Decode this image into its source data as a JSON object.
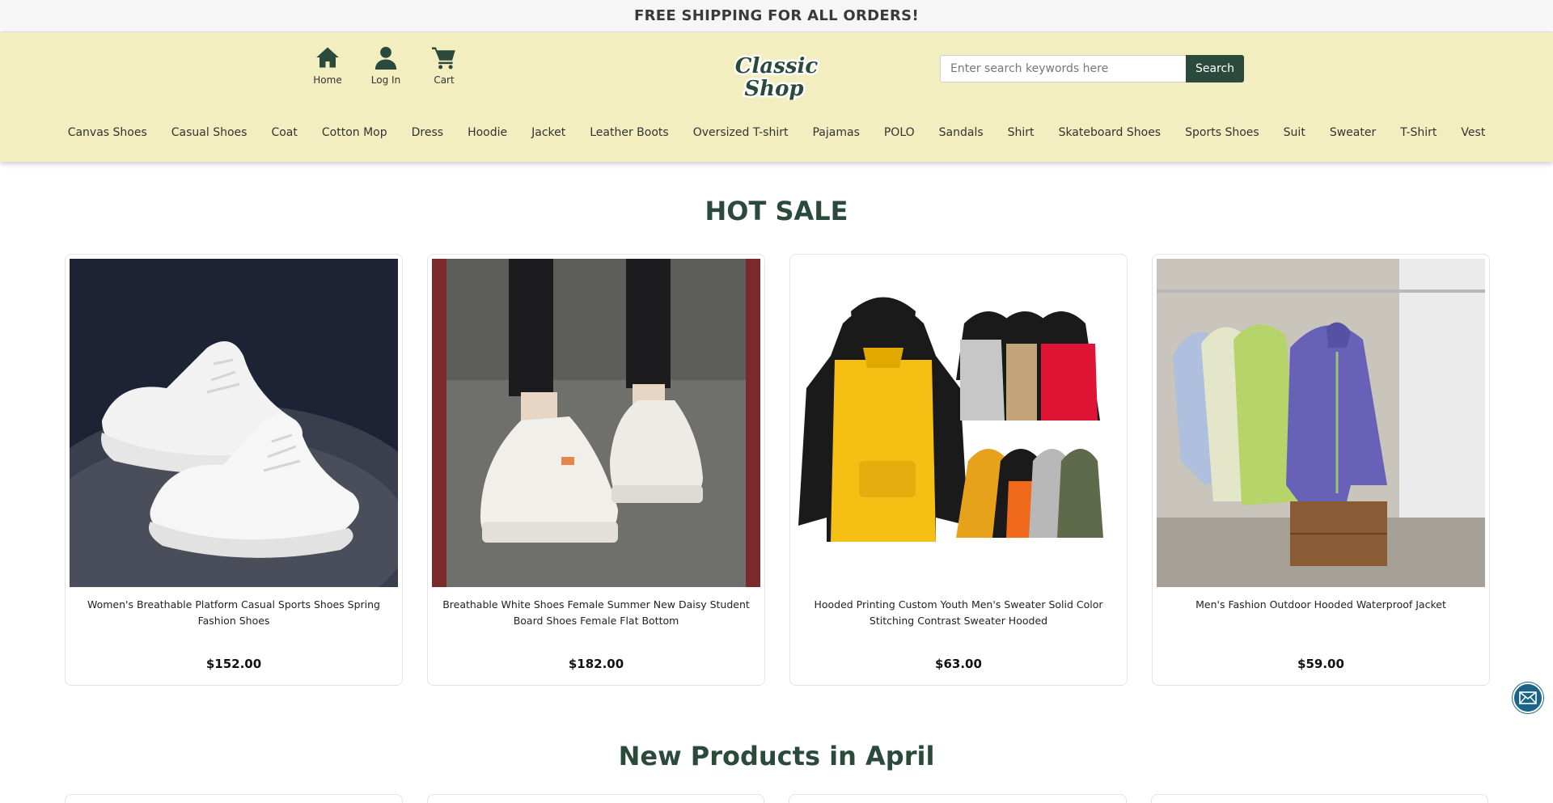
{
  "promo_banner": "FREE SHIPPING FOR ALL ORDERS!",
  "header": {
    "icons": [
      {
        "label": "Home",
        "icon": "home-icon"
      },
      {
        "label": "Log In",
        "icon": "user-icon"
      },
      {
        "label": "Cart",
        "icon": "cart-icon"
      }
    ],
    "logo_line1": "Classic",
    "logo_line2": "Shop",
    "search_placeholder": "Enter search keywords here",
    "search_button": "Search"
  },
  "nav": [
    "Canvas Shoes",
    "Casual Shoes",
    "Coat",
    "Cotton Mop",
    "Dress",
    "Hoodie",
    "Jacket",
    "Leather Boots",
    "Oversized T-shirt",
    "Pajamas",
    "POLO",
    "Sandals",
    "Shirt",
    "Skateboard Shoes",
    "Sports Shoes",
    "Suit",
    "Sweater",
    "T-Shirt",
    "Vest"
  ],
  "hot_sale": {
    "title": "HOT SALE",
    "products": [
      {
        "name": "Women's Breathable Platform Casual Sports Shoes Spring Fashion Shoes",
        "price": "$152.00"
      },
      {
        "name": "Breathable White Shoes Female Summer New Daisy Student Board Shoes Female Flat Bottom",
        "price": "$182.00"
      },
      {
        "name": "Hooded Printing Custom Youth Men's Sweater Solid Color Stitching Contrast Sweater Hooded",
        "price": "$63.00"
      },
      {
        "name": "Men's Fashion Outdoor Hooded Waterproof Jacket",
        "price": "$59.00"
      }
    ]
  },
  "new_products": {
    "title": "New Products in April"
  },
  "colors": {
    "brand_green": "#2b4a3c",
    "header_bg": "#f2eebf",
    "mail_blue": "#1a6587"
  }
}
